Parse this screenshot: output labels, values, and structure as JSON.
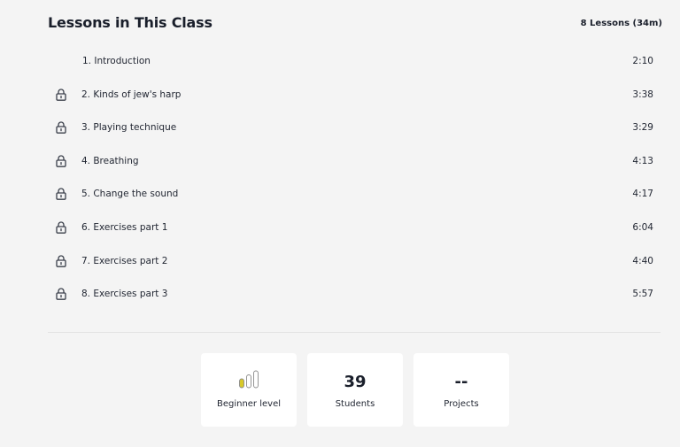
{
  "header": {
    "title": "Lessons in This Class",
    "lesson_count": "8 Lessons (34m)"
  },
  "lessons": [
    {
      "title": "1. Introduction",
      "duration": "2:10",
      "locked": false
    },
    {
      "title": "2. Kinds of jew's harp",
      "duration": "3:38",
      "locked": true
    },
    {
      "title": "3. Playing technique",
      "duration": "3:29",
      "locked": true
    },
    {
      "title": "4. Breathing",
      "duration": "4:13",
      "locked": true
    },
    {
      "title": "5. Change the sound",
      "duration": "4:17",
      "locked": true
    },
    {
      "title": "6. Exercises part 1",
      "duration": "6:04",
      "locked": true
    },
    {
      "title": "7. Exercises part 2",
      "duration": "4:40",
      "locked": true
    },
    {
      "title": "8. Exercises part 3",
      "duration": "5:57",
      "locked": true
    }
  ],
  "stats": {
    "level": {
      "label": "Beginner level",
      "icon": "level-bars-icon",
      "level_filled": 1,
      "level_total": 3,
      "accent": "#d8c928"
    },
    "students": {
      "value": "39",
      "label": "Students"
    },
    "projects": {
      "value": "--",
      "label": "Projects"
    }
  },
  "colors": {
    "background": "#f4f4f4",
    "card": "#ffffff",
    "text": "#1f2430"
  }
}
